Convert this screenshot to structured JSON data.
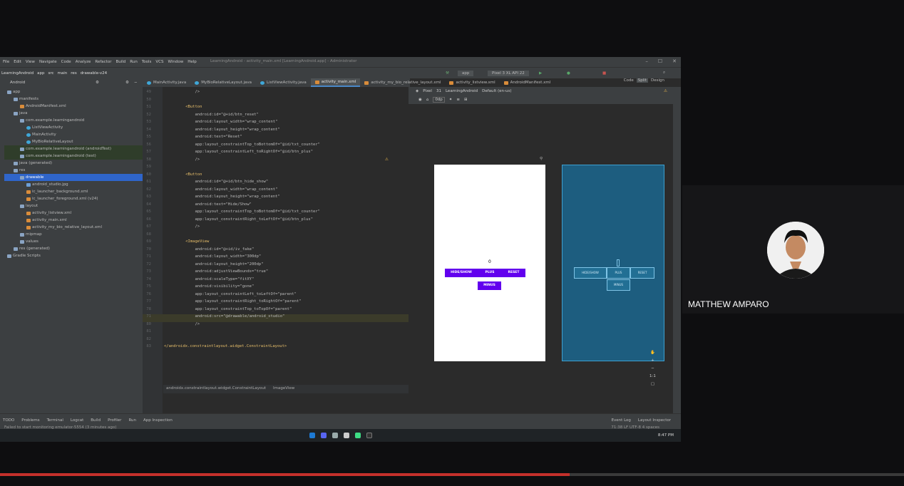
{
  "window": {
    "title": "LearningAndroid - activity_main.xml [LearningAndroid.app] - Administrator",
    "menu": [
      "File",
      "Edit",
      "View",
      "Navigate",
      "Code",
      "Analyze",
      "Refactor",
      "Build",
      "Run",
      "Tools",
      "VCS",
      "Window",
      "Help"
    ],
    "controls": [
      "–",
      "☐",
      "✕"
    ]
  },
  "navbar": {
    "breadcrumbs": [
      "LearningAndroid",
      "app",
      "src",
      "main",
      "res",
      "drawable-v24"
    ],
    "run_config": "app",
    "device": "Pixel 3 XL API 22"
  },
  "project_panel": {
    "view_label": "Android",
    "items": [
      {
        "label": "app",
        "depth": 0,
        "type": "folder",
        "state": ""
      },
      {
        "label": "manifests",
        "depth": 1,
        "type": "folder",
        "state": ""
      },
      {
        "label": "AndroidManifest.xml",
        "depth": 2,
        "type": "xml",
        "state": ""
      },
      {
        "label": "java",
        "depth": 1,
        "type": "folder",
        "state": ""
      },
      {
        "label": "com.example.learningandroid",
        "depth": 2,
        "type": "folder",
        "state": ""
      },
      {
        "label": "ListViewActivity",
        "depth": 3,
        "type": "java",
        "state": ""
      },
      {
        "label": "MainActivity",
        "depth": 3,
        "type": "java",
        "state": ""
      },
      {
        "label": "MyBioRelativeLayout",
        "depth": 3,
        "type": "java",
        "state": ""
      },
      {
        "label": "com.example.learningandroid (androidTest)",
        "depth": 2,
        "type": "folder",
        "state": "green"
      },
      {
        "label": "com.example.learningandroid (test)",
        "depth": 2,
        "type": "folder",
        "state": "green"
      },
      {
        "label": "java (generated)",
        "depth": 1,
        "type": "folder",
        "state": ""
      },
      {
        "label": "res",
        "depth": 1,
        "type": "folder",
        "state": ""
      },
      {
        "label": "drawable",
        "depth": 2,
        "type": "folder",
        "state": "sel"
      },
      {
        "label": "android_studio.jpg",
        "depth": 3,
        "type": "file",
        "state": ""
      },
      {
        "label": "ic_launcher_background.xml",
        "depth": 3,
        "type": "xml",
        "state": ""
      },
      {
        "label": "ic_launcher_foreground.xml (v24)",
        "depth": 3,
        "type": "xml",
        "state": ""
      },
      {
        "label": "layout",
        "depth": 2,
        "type": "folder",
        "state": ""
      },
      {
        "label": "activity_listview.xml",
        "depth": 3,
        "type": "xml",
        "state": ""
      },
      {
        "label": "activity_main.xml",
        "depth": 3,
        "type": "xml",
        "state": ""
      },
      {
        "label": "activity_my_bio_relative_layout.xml",
        "depth": 3,
        "type": "xml",
        "state": ""
      },
      {
        "label": "mipmap",
        "depth": 2,
        "type": "folder",
        "state": ""
      },
      {
        "label": "values",
        "depth": 2,
        "type": "folder",
        "state": ""
      },
      {
        "label": "res (generated)",
        "depth": 1,
        "type": "folder",
        "state": ""
      },
      {
        "label": "Gradle Scripts",
        "depth": 0,
        "type": "folder",
        "state": ""
      }
    ]
  },
  "editor_tabs": [
    {
      "label": "MainActivity.java",
      "active": false
    },
    {
      "label": "MyBioRelativeLayout.java",
      "active": false
    },
    {
      "label": "ListViewActivity.java",
      "active": false
    },
    {
      "label": "activity_main.xml",
      "active": true
    },
    {
      "label": "activity_my_bio_relative_layout.xml",
      "active": false
    },
    {
      "label": "activity_listview.xml",
      "active": false
    },
    {
      "label": "AndroidManifest.xml",
      "active": false
    }
  ],
  "code": [
    {
      "n": "49",
      "t": "        />"
    },
    {
      "n": "50",
      "t": ""
    },
    {
      "n": "51",
      "t": "    <Button"
    },
    {
      "n": "52",
      "t": "        android:id=\"@+id/btn_reset\""
    },
    {
      "n": "53",
      "t": "        android:layout_width=\"wrap_content\""
    },
    {
      "n": "54",
      "t": "        android:layout_height=\"wrap_content\""
    },
    {
      "n": "55",
      "t": "        android:text=\"Reset\""
    },
    {
      "n": "56",
      "t": "        app:layout_constraintTop_toBottomOf=\"@id/txt_counter\""
    },
    {
      "n": "57",
      "t": "        app:layout_constraintLeft_toRightOf=\"@id/btn_plus\""
    },
    {
      "n": "58",
      "t": "        />"
    },
    {
      "n": "59",
      "t": ""
    },
    {
      "n": "60",
      "t": "    <Button"
    },
    {
      "n": "61",
      "t": "        android:id=\"@+id/btn_hide_show\""
    },
    {
      "n": "62",
      "t": "        android:layout_width=\"wrap_content\""
    },
    {
      "n": "63",
      "t": "        android:layout_height=\"wrap_content\""
    },
    {
      "n": "64",
      "t": "        android:text=\"Hide/Show\""
    },
    {
      "n": "65",
      "t": "        app:layout_constraintTop_toBottomOf=\"@id/txt_counter\""
    },
    {
      "n": "66",
      "t": "        app:layout_constraintRight_toLeftOf=\"@id/btn_plus\""
    },
    {
      "n": "67",
      "t": "        />"
    },
    {
      "n": "68",
      "t": ""
    },
    {
      "n": "69",
      "t": "    <ImageView"
    },
    {
      "n": "70",
      "t": "        android:id=\"@+id/iv_fake\""
    },
    {
      "n": "71",
      "t": "        android:layout_width=\"300dp\""
    },
    {
      "n": "72",
      "t": "        android:layout_height=\"200dp\""
    },
    {
      "n": "73",
      "t": "        android:adjustViewBounds=\"true\""
    },
    {
      "n": "74",
      "t": "        android:scaleType=\"fitXY\""
    },
    {
      "n": "75",
      "t": "        android:visibility=\"gone\""
    },
    {
      "n": "76",
      "t": "        app:layout_constraintLeft_toLeftOf=\"parent\""
    },
    {
      "n": "77",
      "t": "        app:layout_constraintRight_toRightOf=\"parent\""
    },
    {
      "n": "78",
      "t": "        app:layout_constraintTop_toTopOf=\"parent\""
    },
    {
      "n": "71",
      "t": "        android:src=\"@drawable/android_studio\""
    },
    {
      "n": "80",
      "t": "        />"
    },
    {
      "n": "81",
      "t": ""
    },
    {
      "n": "82",
      "t": ""
    },
    {
      "n": "83",
      "t": "</androidx.constraintlayout.widget.ConstraintLayout>"
    }
  ],
  "editor_footer": [
    "androidx.constraintlayout.widget.ConstraintLayout",
    "ImageView"
  ],
  "designer": {
    "toolbar": [
      "Pixel",
      "31",
      "LearningAndroid",
      "Default (en-us)"
    ],
    "zoom": "0dp",
    "view_modes": [
      "Code",
      "Split",
      "Design"
    ],
    "preview": {
      "counter": "0",
      "buttons": [
        "HIDE/SHOW",
        "PLUS",
        "RESET",
        "MINUS"
      ]
    },
    "blueprint": {
      "buttons": [
        "HIDE/SHOW",
        "PLUS",
        "RESET",
        "MINUS"
      ]
    },
    "zoom_controls": [
      "+",
      "−",
      "1:1"
    ]
  },
  "bottom_tabs": [
    "TODO",
    "Problems",
    "Terminal",
    "Logcat",
    "Build",
    "Profiler",
    "Run",
    "App Inspection"
  ],
  "bottom_right_tabs": [
    "Event Log",
    "Layout Inspector"
  ],
  "status_message": "Failed to start monitoring emulator-5554 (3 minutes ago)",
  "status_right": "71:38  LF  UTF-8  4 spaces",
  "clock": "8:47 PM",
  "webcam": {
    "name": "MATTHEW AMPARO"
  },
  "video_progress": 0.63
}
